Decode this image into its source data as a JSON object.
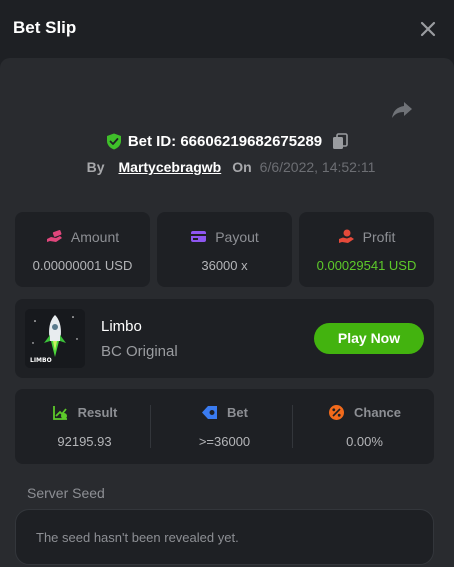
{
  "header": {
    "title": "Bet Slip",
    "close_icon": "close-icon"
  },
  "bet": {
    "id_label": "Bet ID: 66606219682675289",
    "by_label": "By",
    "user": "Martycebragwb",
    "on_label": "On",
    "date": "6/6/2022, 14:52:11"
  },
  "stats": {
    "amount_label": "Amount",
    "amount_value": "0.00000001 USD",
    "payout_label": "Payout",
    "payout_value": "36000 x",
    "profit_label": "Profit",
    "profit_value": "0.00029541 USD"
  },
  "game": {
    "name": "Limbo",
    "provider": "BC Original",
    "thumb_text": "LIMBO",
    "play_label": "Play Now"
  },
  "result": {
    "result_label": "Result",
    "result_value": "92195.93",
    "bet_label": "Bet",
    "bet_value": ">=36000",
    "chance_label": "Chance",
    "chance_value": "0.00%"
  },
  "seed": {
    "label": "Server Seed",
    "text": "The seed hasn't been revealed yet."
  },
  "colors": {
    "accent_green": "#43b30f",
    "profit_green": "#5dca2a",
    "background": "#1e2024",
    "panel": "#292b2f"
  }
}
